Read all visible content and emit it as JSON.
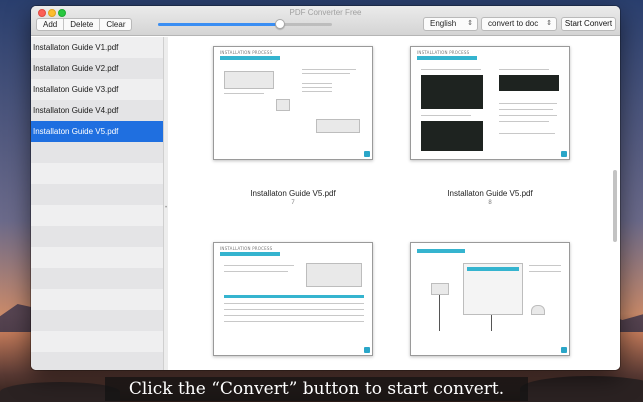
{
  "window": {
    "title": "PDF Converter Free"
  },
  "toolbar": {
    "buttons": [
      {
        "label": "Add"
      },
      {
        "label": "Delete"
      },
      {
        "label": "Clear"
      }
    ],
    "zoom": {
      "value": 0.7
    },
    "language": {
      "selected": "English"
    },
    "format": {
      "selected": "convert to doc"
    },
    "start_label": "Start Convert"
  },
  "files": [
    {
      "name": "Installaton Guide V1.pdf",
      "selected": false
    },
    {
      "name": "Installaton Guide V2.pdf",
      "selected": false
    },
    {
      "name": "Installaton Guide V3.pdf",
      "selected": false
    },
    {
      "name": "Installaton Guide V4.pdf",
      "selected": false
    },
    {
      "name": "Installaton Guide V5.pdf",
      "selected": true
    }
  ],
  "pages": [
    {
      "header": "INSTALLATION PROCESS",
      "caption": "Installaton Guide V5.pdf",
      "number": "7"
    },
    {
      "header": "INSTALLATION PROCESS",
      "caption": "Installaton Guide V5.pdf",
      "number": "8"
    },
    {
      "header": "INSTALLATION PROCESS",
      "caption": "",
      "number": ""
    },
    {
      "header": "",
      "caption": "",
      "number": ""
    }
  ],
  "subtitle": "Click the “Convert” button to start convert.",
  "colors": {
    "selection": "#1f6fe0",
    "accent": "#3a8ef3",
    "page_band": "#35b4cf"
  },
  "icons": {
    "popup_arrow": "⇕",
    "splitter": "•"
  }
}
